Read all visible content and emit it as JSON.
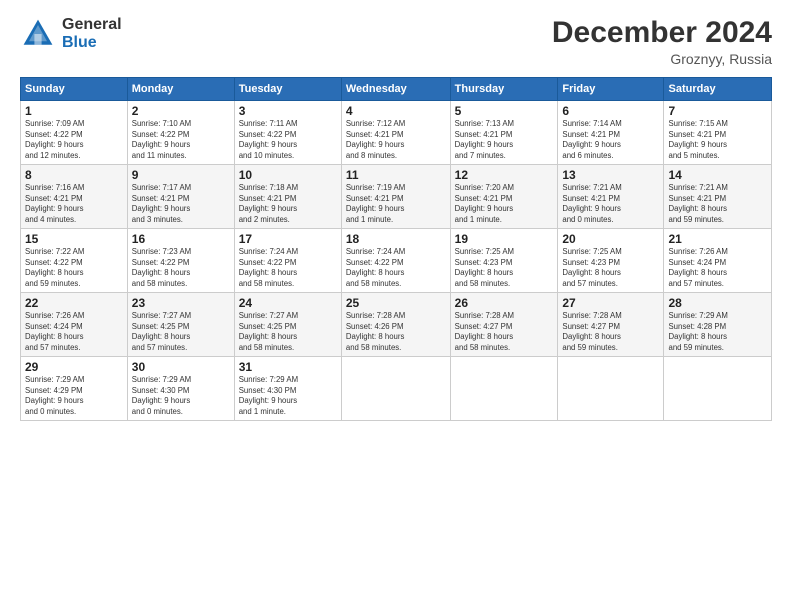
{
  "logo": {
    "general": "General",
    "blue": "Blue"
  },
  "title": "December 2024",
  "subtitle": "Groznyy, Russia",
  "days_of_week": [
    "Sunday",
    "Monday",
    "Tuesday",
    "Wednesday",
    "Thursday",
    "Friday",
    "Saturday"
  ],
  "weeks": [
    [
      {
        "day": "1",
        "info": "Sunrise: 7:09 AM\nSunset: 4:22 PM\nDaylight: 9 hours\nand 12 minutes."
      },
      {
        "day": "2",
        "info": "Sunrise: 7:10 AM\nSunset: 4:22 PM\nDaylight: 9 hours\nand 11 minutes."
      },
      {
        "day": "3",
        "info": "Sunrise: 7:11 AM\nSunset: 4:22 PM\nDaylight: 9 hours\nand 10 minutes."
      },
      {
        "day": "4",
        "info": "Sunrise: 7:12 AM\nSunset: 4:21 PM\nDaylight: 9 hours\nand 8 minutes."
      },
      {
        "day": "5",
        "info": "Sunrise: 7:13 AM\nSunset: 4:21 PM\nDaylight: 9 hours\nand 7 minutes."
      },
      {
        "day": "6",
        "info": "Sunrise: 7:14 AM\nSunset: 4:21 PM\nDaylight: 9 hours\nand 6 minutes."
      },
      {
        "day": "7",
        "info": "Sunrise: 7:15 AM\nSunset: 4:21 PM\nDaylight: 9 hours\nand 5 minutes."
      }
    ],
    [
      {
        "day": "8",
        "info": "Sunrise: 7:16 AM\nSunset: 4:21 PM\nDaylight: 9 hours\nand 4 minutes."
      },
      {
        "day": "9",
        "info": "Sunrise: 7:17 AM\nSunset: 4:21 PM\nDaylight: 9 hours\nand 3 minutes."
      },
      {
        "day": "10",
        "info": "Sunrise: 7:18 AM\nSunset: 4:21 PM\nDaylight: 9 hours\nand 2 minutes."
      },
      {
        "day": "11",
        "info": "Sunrise: 7:19 AM\nSunset: 4:21 PM\nDaylight: 9 hours\nand 1 minute."
      },
      {
        "day": "12",
        "info": "Sunrise: 7:20 AM\nSunset: 4:21 PM\nDaylight: 9 hours\nand 1 minute."
      },
      {
        "day": "13",
        "info": "Sunrise: 7:21 AM\nSunset: 4:21 PM\nDaylight: 9 hours\nand 0 minutes."
      },
      {
        "day": "14",
        "info": "Sunrise: 7:21 AM\nSunset: 4:21 PM\nDaylight: 8 hours\nand 59 minutes."
      }
    ],
    [
      {
        "day": "15",
        "info": "Sunrise: 7:22 AM\nSunset: 4:22 PM\nDaylight: 8 hours\nand 59 minutes."
      },
      {
        "day": "16",
        "info": "Sunrise: 7:23 AM\nSunset: 4:22 PM\nDaylight: 8 hours\nand 58 minutes."
      },
      {
        "day": "17",
        "info": "Sunrise: 7:24 AM\nSunset: 4:22 PM\nDaylight: 8 hours\nand 58 minutes."
      },
      {
        "day": "18",
        "info": "Sunrise: 7:24 AM\nSunset: 4:22 PM\nDaylight: 8 hours\nand 58 minutes."
      },
      {
        "day": "19",
        "info": "Sunrise: 7:25 AM\nSunset: 4:23 PM\nDaylight: 8 hours\nand 58 minutes."
      },
      {
        "day": "20",
        "info": "Sunrise: 7:25 AM\nSunset: 4:23 PM\nDaylight: 8 hours\nand 57 minutes."
      },
      {
        "day": "21",
        "info": "Sunrise: 7:26 AM\nSunset: 4:24 PM\nDaylight: 8 hours\nand 57 minutes."
      }
    ],
    [
      {
        "day": "22",
        "info": "Sunrise: 7:26 AM\nSunset: 4:24 PM\nDaylight: 8 hours\nand 57 minutes."
      },
      {
        "day": "23",
        "info": "Sunrise: 7:27 AM\nSunset: 4:25 PM\nDaylight: 8 hours\nand 57 minutes."
      },
      {
        "day": "24",
        "info": "Sunrise: 7:27 AM\nSunset: 4:25 PM\nDaylight: 8 hours\nand 58 minutes."
      },
      {
        "day": "25",
        "info": "Sunrise: 7:28 AM\nSunset: 4:26 PM\nDaylight: 8 hours\nand 58 minutes."
      },
      {
        "day": "26",
        "info": "Sunrise: 7:28 AM\nSunset: 4:27 PM\nDaylight: 8 hours\nand 58 minutes."
      },
      {
        "day": "27",
        "info": "Sunrise: 7:28 AM\nSunset: 4:27 PM\nDaylight: 8 hours\nand 59 minutes."
      },
      {
        "day": "28",
        "info": "Sunrise: 7:29 AM\nSunset: 4:28 PM\nDaylight: 8 hours\nand 59 minutes."
      }
    ],
    [
      {
        "day": "29",
        "info": "Sunrise: 7:29 AM\nSunset: 4:29 PM\nDaylight: 9 hours\nand 0 minutes."
      },
      {
        "day": "30",
        "info": "Sunrise: 7:29 AM\nSunset: 4:30 PM\nDaylight: 9 hours\nand 0 minutes."
      },
      {
        "day": "31",
        "info": "Sunrise: 7:29 AM\nSunset: 4:30 PM\nDaylight: 9 hours\nand 1 minute."
      },
      null,
      null,
      null,
      null
    ]
  ]
}
